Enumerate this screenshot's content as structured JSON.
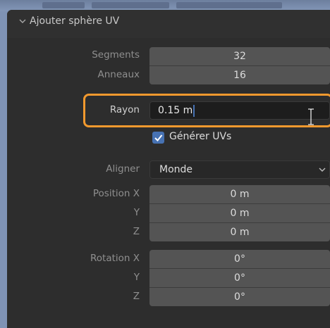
{
  "panel": {
    "title": "Ajouter sphère UV"
  },
  "fields": {
    "segments": {
      "label": "Segments",
      "value": "32"
    },
    "rings": {
      "label": "Anneaux",
      "value": "16"
    },
    "radius": {
      "label": "Rayon",
      "value": "0.15 m"
    },
    "generate_uvs": {
      "label": "Générer UVs",
      "checked": true
    },
    "align": {
      "label": "Aligner",
      "value": "Monde"
    },
    "location": {
      "label_x": "Position X",
      "label_y": "Y",
      "label_z": "Z",
      "x": "0 m",
      "y": "0 m",
      "z": "0 m"
    },
    "rotation": {
      "label_x": "Rotation X",
      "label_y": "Y",
      "label_z": "Z",
      "x": "0°",
      "y": "0°",
      "z": "0°"
    }
  },
  "colors": {
    "highlight_box": "#f2992e",
    "checkbox": "#4772b3",
    "panel_bg": "#2d2d2d"
  },
  "icons": [
    "chevron-down-icon",
    "checkmark-icon",
    "dropdown-chevron-icon",
    "text-cursor-icon"
  ]
}
